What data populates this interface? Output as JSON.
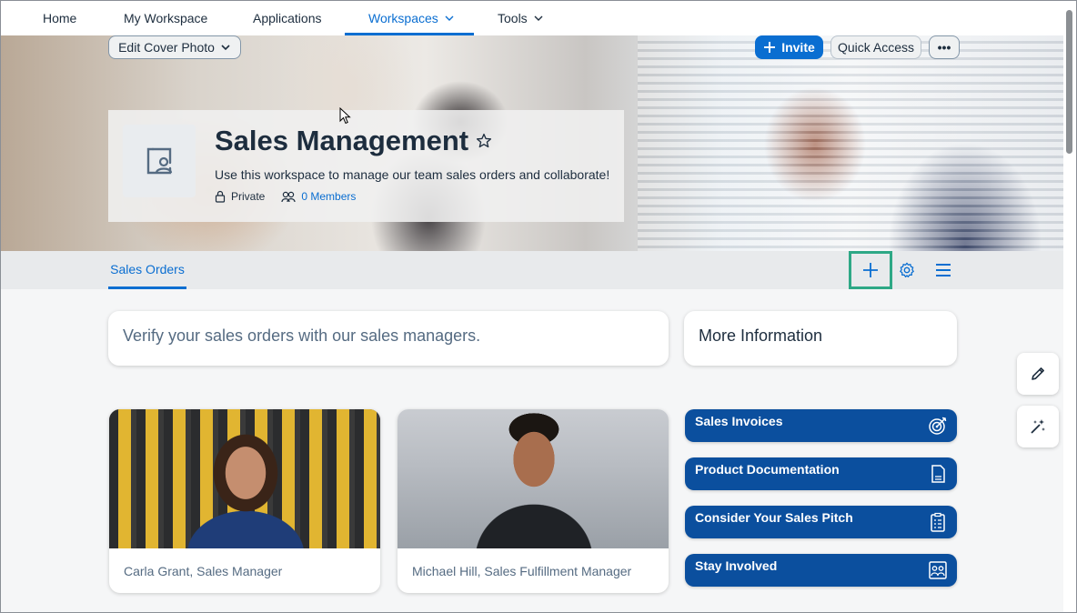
{
  "nav": {
    "items": [
      {
        "label": "Home"
      },
      {
        "label": "My Workspace"
      },
      {
        "label": "Applications"
      },
      {
        "label": "Workspaces",
        "active": true,
        "icon": "chevron-down-icon"
      },
      {
        "label": "Tools",
        "icon": "chevron-down-icon"
      }
    ]
  },
  "hero": {
    "edit_cover_label": "Edit Cover Photo",
    "invite_label": "Invite",
    "quick_access_label": "Quick Access",
    "more_label": "•••",
    "title": "Sales Management",
    "description": "Use this workspace to manage our team sales orders and collaborate!",
    "privacy": "Private",
    "members": "0 Members"
  },
  "tabs": [
    {
      "label": "Sales Orders",
      "active": true
    }
  ],
  "toolbar": {
    "icons": [
      "add-icon",
      "settings-icon",
      "menu-icon"
    ],
    "highlight_color": "#2ea886"
  },
  "content": {
    "verify_text": "Verify your sales orders with our sales managers.",
    "more_info_title": "More Information",
    "people": [
      {
        "caption": "Carla Grant, Sales Manager"
      },
      {
        "caption": "Michael Hill, Sales Fulfillment Manager"
      }
    ],
    "links": [
      {
        "label": "Sales Invoices",
        "icon": "target-icon"
      },
      {
        "label": "Product Documentation",
        "icon": "document-icon"
      },
      {
        "label": "Consider Your Sales Pitch",
        "icon": "checklist-icon"
      },
      {
        "label": "Stay Involved",
        "icon": "people-presentation-icon"
      }
    ]
  },
  "side_actions": [
    "edit-icon",
    "magic-wand-icon"
  ],
  "colors": {
    "accent": "#0a6ed1",
    "tile": "#0b4f9e",
    "text": "#1d2d3e"
  }
}
